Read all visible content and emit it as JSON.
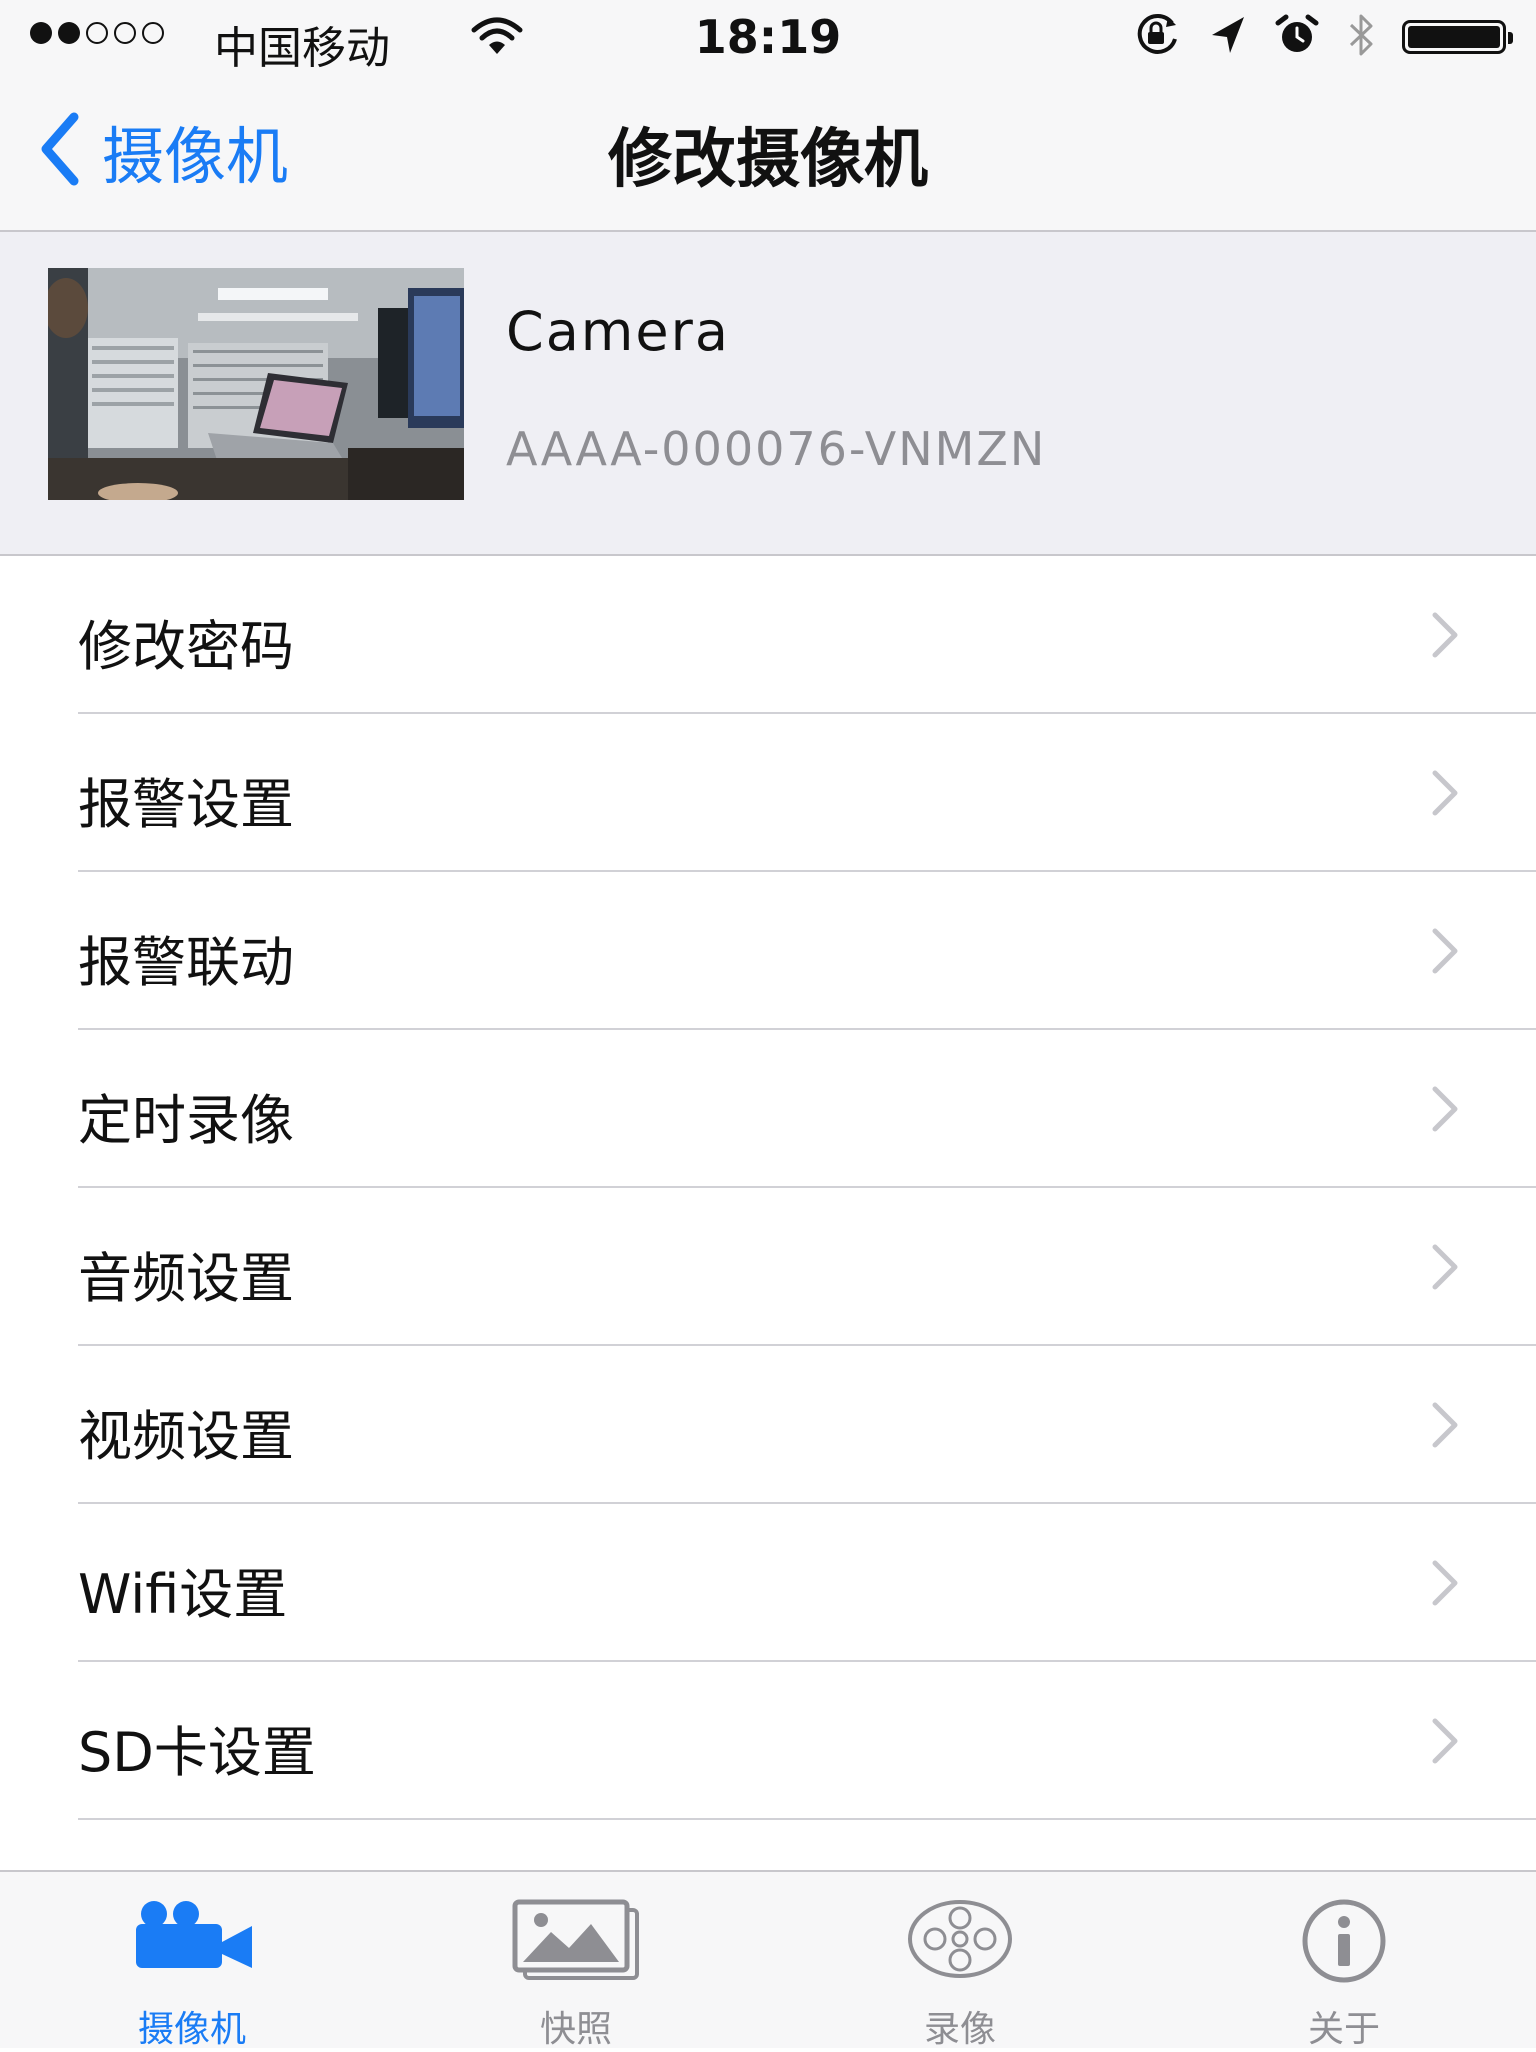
{
  "status_bar": {
    "signal_bars_filled": 2,
    "signal_bars_total": 5,
    "carrier": "中国移动",
    "time": "18:19",
    "icons": [
      "wifi-icon",
      "orientation-lock-icon",
      "location-icon",
      "alarm-icon",
      "bluetooth-icon",
      "battery-icon"
    ]
  },
  "nav": {
    "back_label": "摄像机",
    "title": "修改摄像机"
  },
  "camera": {
    "name": "Camera",
    "uid": "AAAA-000076-VNMZN"
  },
  "menu": {
    "items": [
      {
        "label": "修改密码"
      },
      {
        "label": "报警设置"
      },
      {
        "label": "报警联动"
      },
      {
        "label": "定时录像"
      },
      {
        "label": "音频设置"
      },
      {
        "label": "视频设置"
      },
      {
        "label": "Wifi设置"
      },
      {
        "label": "SD卡设置"
      }
    ]
  },
  "tabs": [
    {
      "label": "摄像机",
      "icon": "video-camera-icon",
      "active": true
    },
    {
      "label": "快照",
      "icon": "photos-icon",
      "active": false
    },
    {
      "label": "录像",
      "icon": "film-reel-icon",
      "active": false
    },
    {
      "label": "关于",
      "icon": "info-icon",
      "active": false
    }
  ],
  "colors": {
    "accent": "#1a7cf5",
    "inactive": "#8e8e93",
    "header_bg": "#efeff4",
    "bar_bg": "#f7f7f8"
  }
}
